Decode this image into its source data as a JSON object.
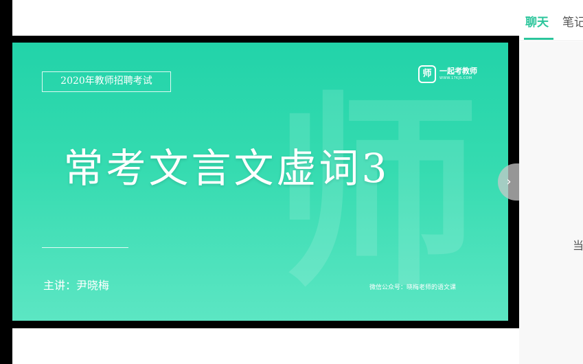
{
  "video": {
    "exam_tag": "2020年教师招聘考试",
    "brand_logo_glyph": "师",
    "brand_name": "一起考教师",
    "brand_url": "WWW.17KJS.COM",
    "watermark_glyph": "师",
    "title": "常考文言文虚词3",
    "speaker": "主讲：尹晓梅",
    "wechat_note": "微信公众号：晓梅老师的语文课"
  },
  "side_panel": {
    "tabs": [
      {
        "label": "聊天",
        "active": true
      },
      {
        "label": "笔记",
        "active": false
      }
    ],
    "hint_partial": "当"
  },
  "controls": {
    "collapse_icon": "chevron-right-icon",
    "collapse_glyph": "›"
  },
  "colors": {
    "accent": "#2bc59b",
    "slide_green": "#22d3a9"
  }
}
